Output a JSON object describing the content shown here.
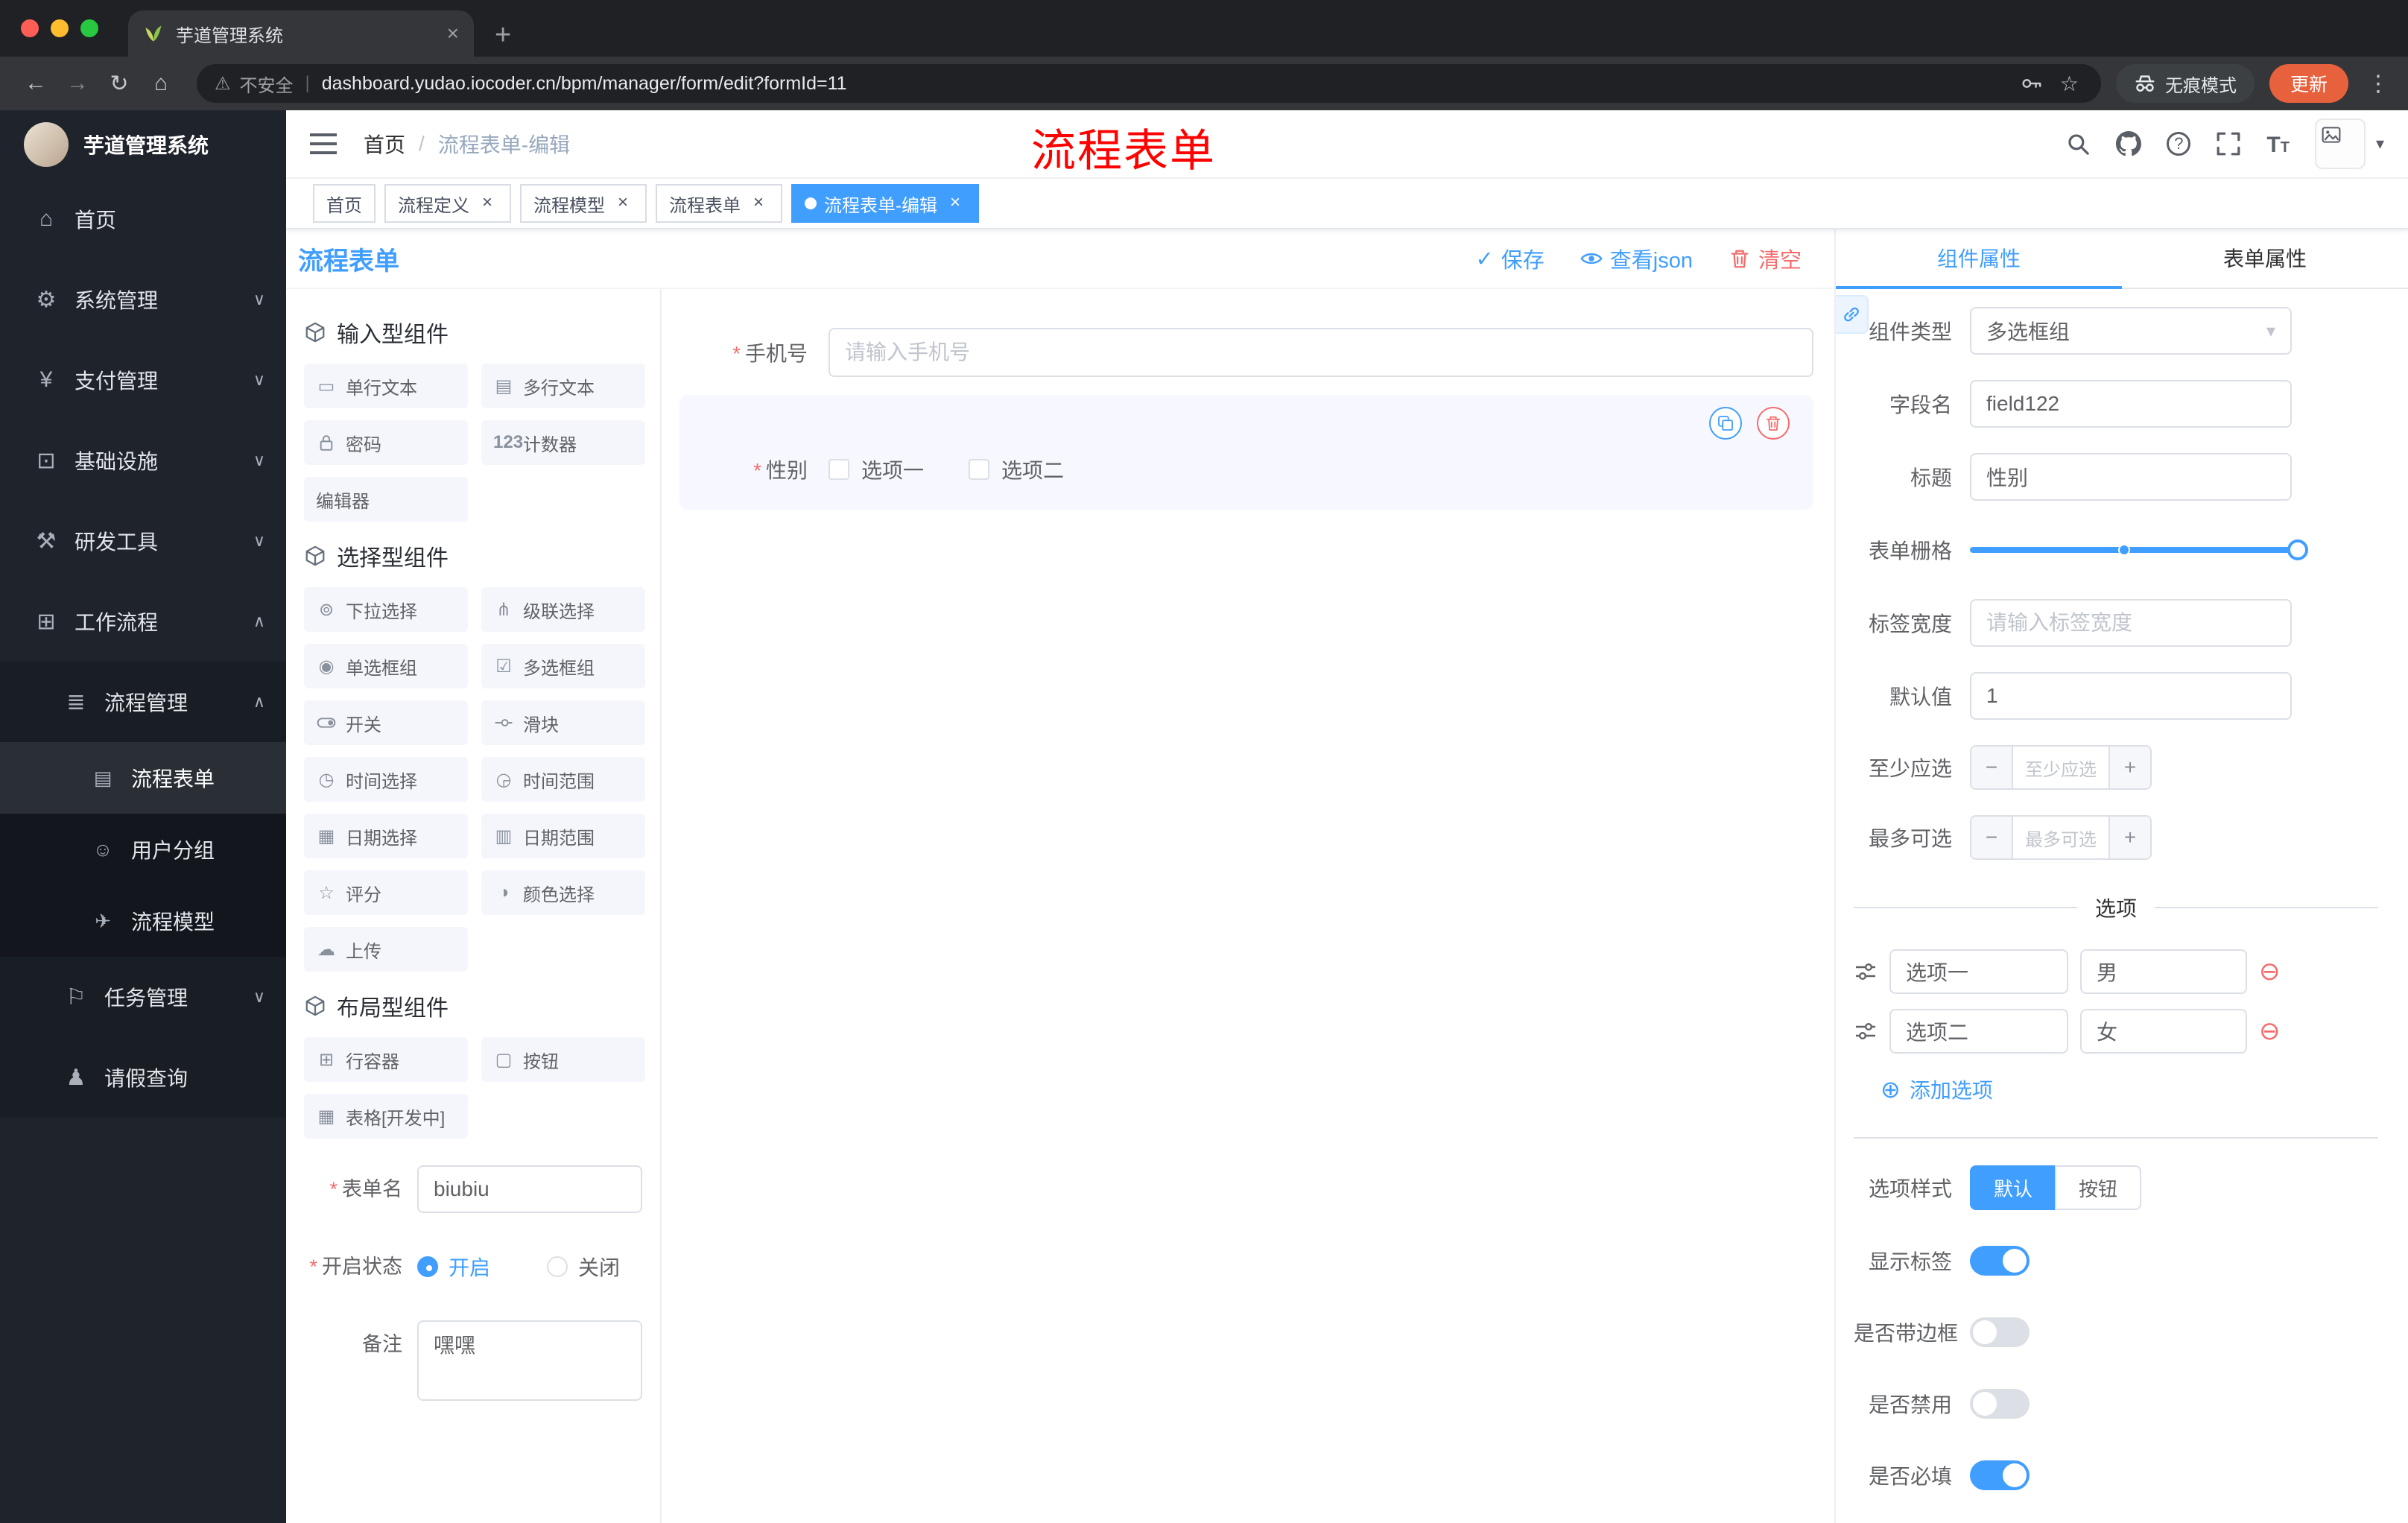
{
  "colors": {
    "primary": "#409eff",
    "danger": "#f56c6c",
    "update_badge": "#e8613d",
    "tag_active": "#409eff",
    "sidebar_bg": "#1f242c"
  },
  "browser": {
    "tab_title": "芋道管理系统",
    "security": "不安全",
    "url": "dashboard.yudao.iocoder.cn/bpm/manager/form/edit?formId=11",
    "incognito": "无痕模式",
    "update": "更新"
  },
  "glyphs": {
    "back": "←",
    "forward": "→",
    "reload": "↻",
    "home": "⌂",
    "warning": "⚠",
    "pipe": "|",
    "star": "☆",
    "kebab": "⋮",
    "new_tab": "+",
    "close": "×",
    "slash": "/",
    "check": "✓",
    "caret": "▾",
    "minus": "−",
    "plus": "+",
    "add_circle": "⊕",
    "remove_circle": "⊖",
    "question": "?",
    "asterisk": "*",
    "font_big": "T",
    "font_small": "T",
    "dot": "●",
    "arrow_down": "∨",
    "arrow_up": "∧",
    "menu_home": "⌂",
    "menu_system": "⚙",
    "menu_pay": "¥",
    "menu_infra": "⊡",
    "menu_dev": "⚒",
    "menu_flow": "⊞",
    "menu_mgmt": "≣",
    "menu_form": "▤",
    "menu_group": "☺",
    "menu_model": "✈",
    "menu_task": "⚐",
    "menu_leave": "♟",
    "c_input": "▭",
    "c_textarea": "▤",
    "c_counter": "123",
    "c_select": "⊚",
    "c_cascade": "⋔",
    "c_radio": "◉",
    "c_checkbox": "☑",
    "c_time": "◷",
    "c_timerange": "◶",
    "c_date": "▦",
    "c_daterange": "▥",
    "c_rate": "☆",
    "c_color": "◑",
    "c_upload": "☁",
    "c_row": "⊞",
    "c_button": "▢",
    "c_table": "▦"
  },
  "sidebar": {
    "logo_title": "芋道管理系统",
    "items": {
      "home": "首页",
      "system": "系统管理",
      "pay": "支付管理",
      "infra": "基础设施",
      "dev": "研发工具",
      "flow": "工作流程",
      "flow_mgmt": "流程管理",
      "flow_form": "流程表单",
      "user_group": "用户分组",
      "flow_model": "流程模型",
      "task_mgmt": "任务管理",
      "leave_query": "请假查询"
    }
  },
  "header": {
    "breadcrumb": {
      "home": "首页",
      "current": "流程表单-编辑"
    },
    "annotation": "流程表单"
  },
  "tags": [
    {
      "label": "首页",
      "active": false,
      "closable": false
    },
    {
      "label": "流程定义",
      "active": false,
      "closable": true
    },
    {
      "label": "流程模型",
      "active": false,
      "closable": true
    },
    {
      "label": "流程表单",
      "active": false,
      "closable": true
    },
    {
      "label": "流程表单-编辑",
      "active": true,
      "closable": true
    }
  ],
  "designer": {
    "title": "流程表单",
    "save": "保存",
    "view_json": "查看json",
    "clear": "清空",
    "groups": {
      "input": {
        "title": "输入型组件",
        "items": [
          "单行文本",
          "多行文本",
          "密码",
          "计数器",
          "编辑器"
        ]
      },
      "select": {
        "title": "选择型组件",
        "items": [
          "下拉选择",
          "级联选择",
          "单选框组",
          "多选框组",
          "开关",
          "滑块",
          "时间选择",
          "时间范围",
          "日期选择",
          "日期范围",
          "评分",
          "颜色选择",
          "上传"
        ]
      },
      "layout": {
        "title": "布局型组件",
        "items": [
          "行容器",
          "按钮",
          "表格[开发中]"
        ]
      }
    },
    "meta": {
      "name_label": "表单名",
      "name_value": "biubiu",
      "status_label": "开启状态",
      "status_on": "开启",
      "status_off": "关闭",
      "remark_label": "备注",
      "remark_value": "嘿嘿"
    },
    "canvas": {
      "phone_label": "手机号",
      "phone_placeholder": "请输入手机号",
      "gender_label": "性别",
      "gender_opt1": "选项一",
      "gender_opt2": "选项二"
    }
  },
  "props": {
    "tab_component": "组件属性",
    "tab_form": "表单属性",
    "type_label": "组件类型",
    "type_value": "多选框组",
    "field_label": "字段名",
    "field_value": "field122",
    "title_label": "标题",
    "title_value": "性别",
    "grid_label": "表单栅格",
    "width_label": "标签宽度",
    "width_placeholder": "请输入标签宽度",
    "default_label": "默认值",
    "default_value": "1",
    "min_label": "至少应选",
    "min_placeholder": "至少应选",
    "max_label": "最多可选",
    "max_placeholder": "最多可选",
    "options_title": "选项",
    "options": [
      {
        "name": "选项一",
        "value": "男"
      },
      {
        "name": "选项二",
        "value": "女"
      }
    ],
    "add_option": "添加选项",
    "style_label": "选项样式",
    "style_default": "默认",
    "style_button": "按钮",
    "show_label": "显示标签",
    "border_label": "是否带边框",
    "disabled_label": "是否禁用",
    "required_label": "是否必填"
  }
}
